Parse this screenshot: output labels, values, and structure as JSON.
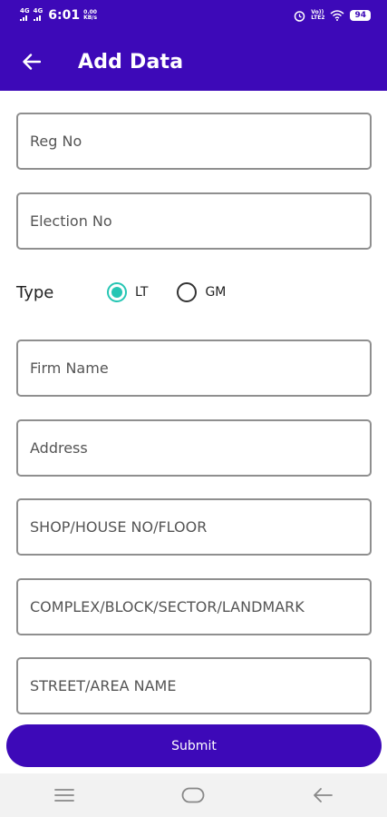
{
  "status_bar": {
    "network_left": "4G",
    "network_right": "4G",
    "time": "6:01",
    "speed_value": "0.00",
    "speed_unit": "KB/s",
    "volte_top": "Vo))",
    "volte_bottom": "LTE2",
    "battery": "94"
  },
  "app_bar": {
    "title": "Add Data",
    "back_icon": "arrow-back-icon"
  },
  "form": {
    "reg_no": {
      "placeholder": "Reg No",
      "value": ""
    },
    "election_no": {
      "placeholder": "Election No",
      "value": ""
    },
    "type": {
      "label": "Type",
      "options": [
        {
          "label": "LT",
          "selected": true
        },
        {
          "label": "GM",
          "selected": false
        }
      ],
      "accent_color": "#26c6b4"
    },
    "firm_name": {
      "placeholder": "Firm Name",
      "value": ""
    },
    "address": {
      "placeholder": "Address",
      "value": ""
    },
    "shop_house": {
      "placeholder": "SHOP/HOUSE NO/FLOOR",
      "value": ""
    },
    "complex": {
      "placeholder": "COMPLEX/BLOCK/SECTOR/LANDMARK",
      "value": ""
    },
    "street": {
      "placeholder": "STREET/AREA NAME",
      "value": ""
    }
  },
  "submit_label": "Submit",
  "nav_bar": {
    "icons": [
      "menu-icon",
      "home-icon",
      "back-icon"
    ]
  },
  "colors": {
    "primary": "#3d09b8",
    "accent": "#26c6b4",
    "field_border": "#8f8f8f"
  }
}
